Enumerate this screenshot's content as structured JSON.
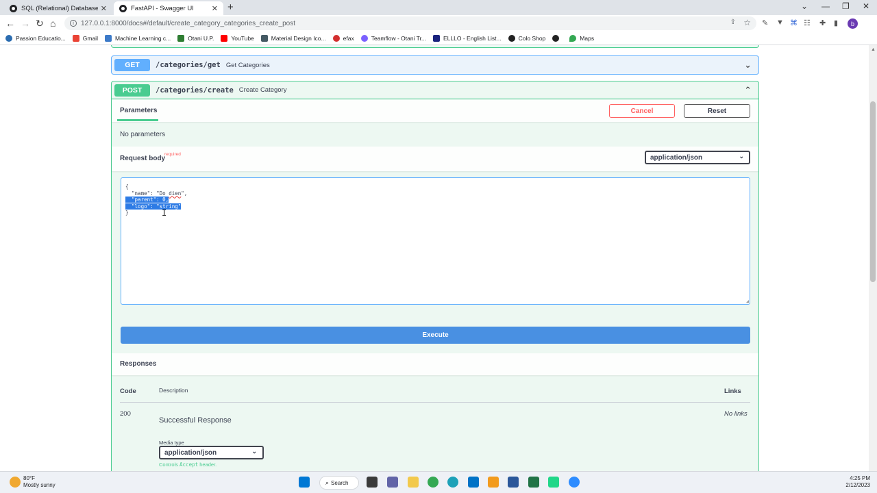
{
  "browser": {
    "tabs": [
      {
        "label": "SQL (Relational) Databases with F",
        "close": "✕"
      },
      {
        "label": "FastAPI - Swagger UI",
        "close": "✕"
      }
    ],
    "new_tab": "+",
    "window_controls": [
      "⌄",
      "—",
      "❐",
      "✕"
    ],
    "url": "127.0.0.1:8000/docs#/default/create_category_categories_create_post",
    "avatar_letter": "b",
    "bookmarks": [
      {
        "label": "Passion Educatio...",
        "color": "#2b6cb0"
      },
      {
        "label": "Gmail",
        "color": "#ea4335"
      },
      {
        "label": "Machine Learning c...",
        "color": "#3c7ac8"
      },
      {
        "label": "Otani U.P.",
        "color": "#2e7d32"
      },
      {
        "label": "YouTube",
        "color": "#ff0000"
      },
      {
        "label": "Material Design Ico...",
        "color": "#455a64"
      },
      {
        "label": "efax",
        "color": "#d32f2f"
      },
      {
        "label": "Teamflow - Otani Tr...",
        "color": "#7b61ff"
      },
      {
        "label": "ELLLO - English List...",
        "color": "#1a237e"
      },
      {
        "label": "Colo Shop",
        "color": "#222222"
      },
      {
        "label": "",
        "color": "#222222"
      },
      {
        "label": "Maps",
        "color": "#34a853"
      }
    ]
  },
  "swagger": {
    "get_op": {
      "method": "GET",
      "path": "/categories/get",
      "summary": "Get Categories",
      "chevron": "⌄"
    },
    "post_op": {
      "method": "POST",
      "path": "/categories/create",
      "summary": "Create Category",
      "chevron": "⌃"
    },
    "parameters": {
      "tab_label": "Parameters",
      "cancel_label": "Cancel",
      "reset_label": "Reset",
      "empty_text": "No parameters"
    },
    "request_body": {
      "title": "Request body",
      "required_label": "required",
      "content_type": "application/json",
      "editor_lines": [
        "{",
        "  \"name\": \"Do dien\",",
        "  \"parent\": 0,",
        "  \"logo\": \"string\"",
        "}"
      ]
    },
    "execute_label": "Execute",
    "responses": {
      "title": "Responses",
      "col_code": "Code",
      "col_description": "Description",
      "col_links": "Links",
      "rows": [
        {
          "code": "200",
          "description": "Successful Response",
          "links": "No links"
        }
      ],
      "media_type_label": "Media type",
      "media_type_value": "application/json",
      "controls_note_prefix": "Controls",
      "controls_note_code": "Accept",
      "controls_note_suffix": "header."
    }
  },
  "taskbar": {
    "temperature": "80°F",
    "condition": "Mostly sunny",
    "search_label": "Search",
    "time": "4:25 PM",
    "date": "2/12/2023"
  }
}
